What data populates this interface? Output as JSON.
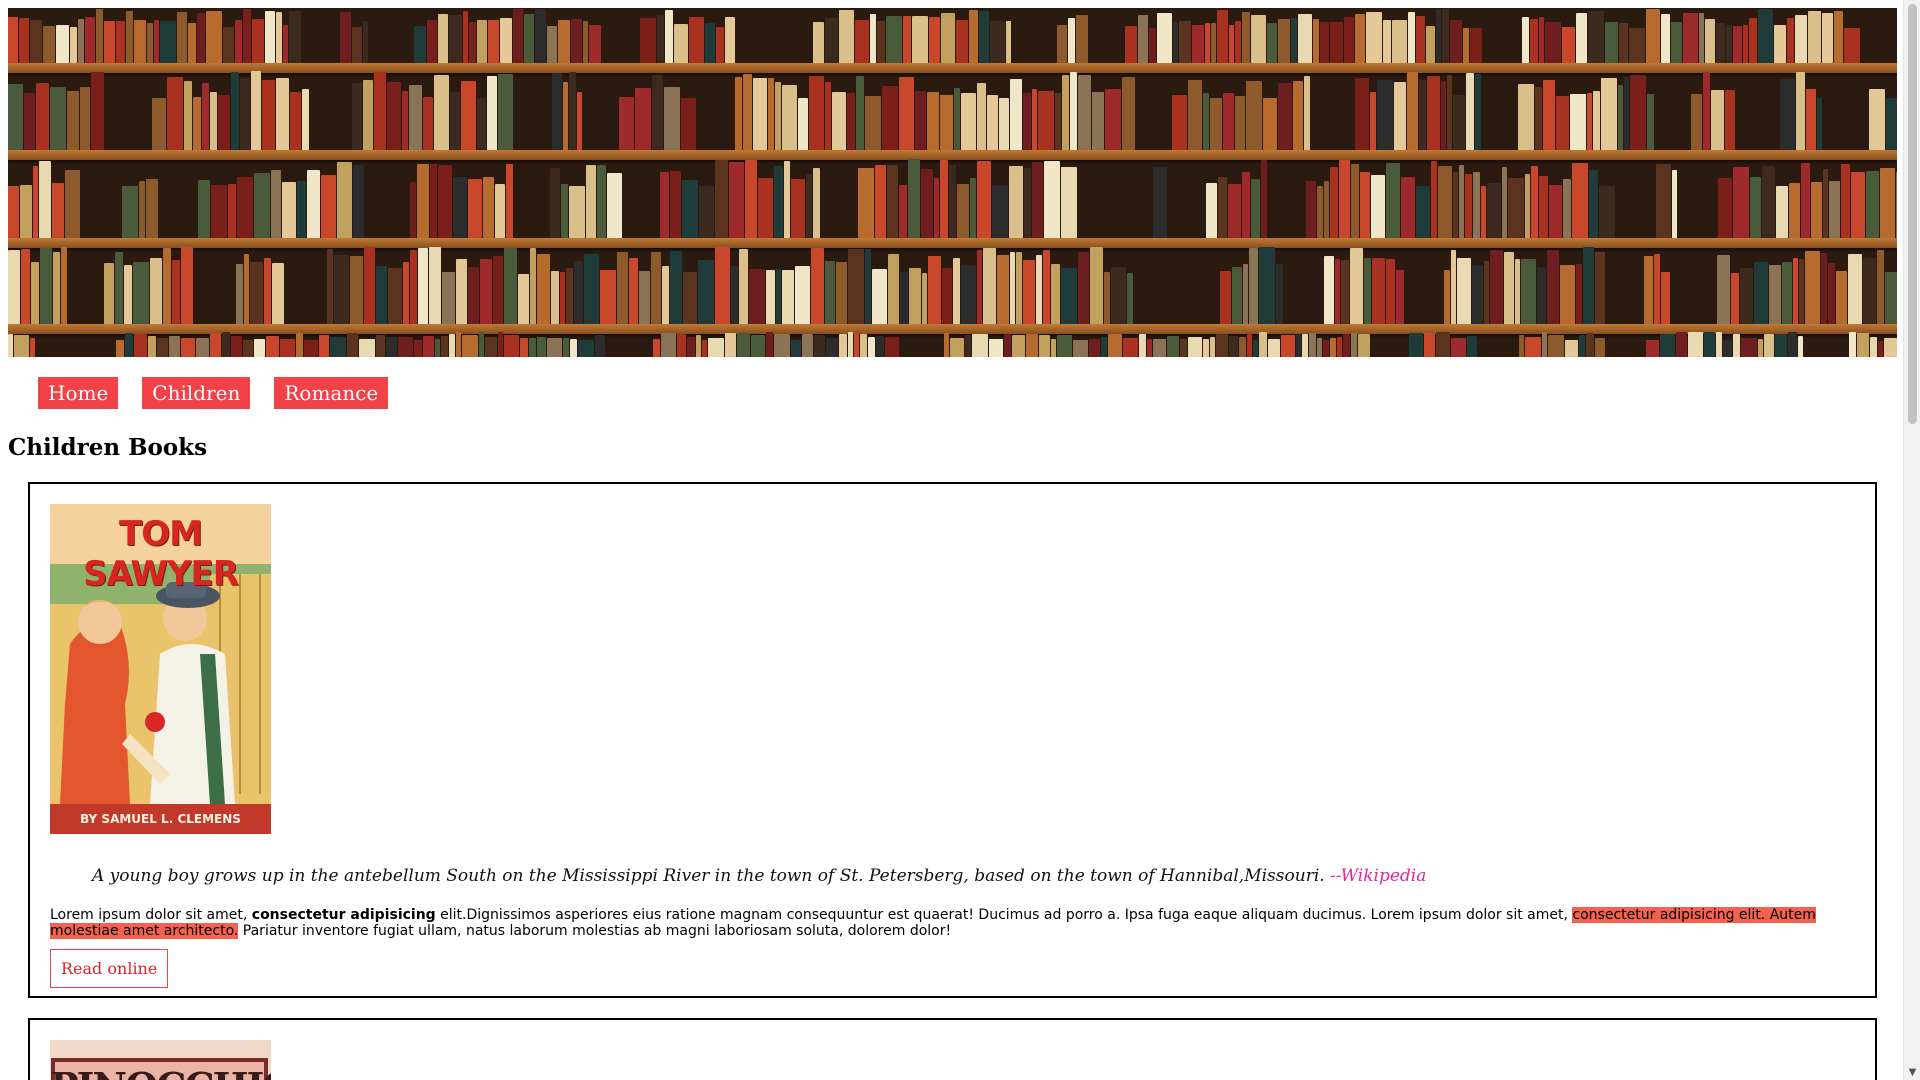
{
  "banner": {
    "alt": "bookshelf-banner"
  },
  "nav": {
    "items": [
      {
        "label": "Home"
      },
      {
        "label": "Children"
      },
      {
        "label": "Romance"
      }
    ]
  },
  "section": {
    "title": "Children Books"
  },
  "books": [
    {
      "cover_title": "TOM SAWYER",
      "cover_author": "BY SAMUEL L. CLEMENS",
      "quote": "A young boy grows up in the antebellum South on the Mississippi River in the town of St. Petersberg, based on the town of Hannibal,Missouri.",
      "quote_source": "--Wikipedia",
      "text_part1": "Lorem ipsum dolor sit amet, ",
      "text_bold": "consectetur adipisicing",
      "text_part2": " elit.Dignissimos asperiores eius ratione magnam consequuntur est quaerat! Ducimus ad porro a. Ipsa fuga eaque aliquam ducimus. Lorem ipsum dolor sit amet, ",
      "text_highlight": "consectetur adipisicing elit. Autem molestiae amet architecto.",
      "text_part3": " Pariatur inventore fugiat ullam, natus laborum molestias ab magni laboriosam soluta, dolorem dolor!",
      "button_label": "Read online"
    },
    {
      "cover_title": "PINOCCHIO"
    }
  ],
  "colors": {
    "nav_bg": "#f24147",
    "highlight": "#f3624f",
    "quote_source": "#e0269a",
    "button_text": "#e0232a"
  }
}
